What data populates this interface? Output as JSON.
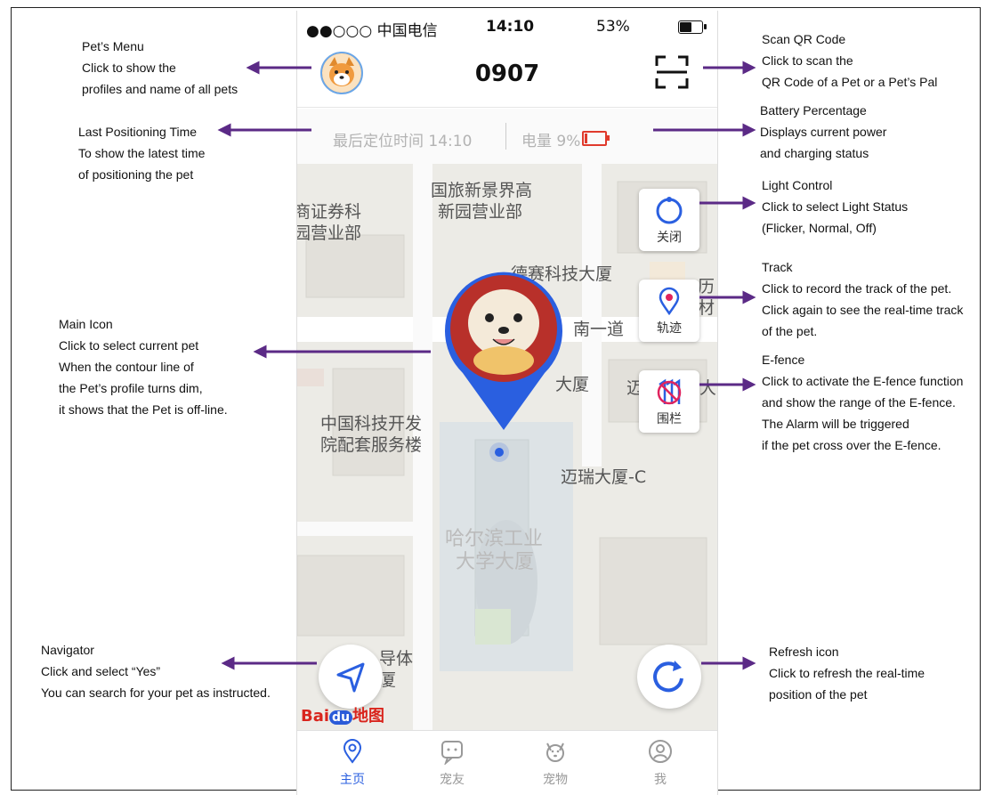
{
  "status_bar": {
    "carrier": "●●○○○ 中国电信",
    "time": "14:10",
    "right": "53%"
  },
  "header": {
    "title": "0907"
  },
  "info_bar": {
    "last_position": "最后定位时间 14:10",
    "battery": "电量 9%"
  },
  "map": {
    "pois": [
      "国旅新景界高",
      "新园营业部",
      "商证券科",
      "园营业部",
      "德赛科技大厦",
      "南一道",
      "大厦",
      "迈",
      "大",
      "中国科技开发",
      "院配套服务楼",
      "迈瑞大厦-C",
      "哈尔滨工业",
      "大学大厦",
      "导体",
      "厦",
      "历",
      "材"
    ],
    "watermark": {
      "bai": "Bai",
      "du": "du",
      "map": "地图"
    }
  },
  "controls": {
    "light_label": "关闭",
    "track_label": "轨迹",
    "fence_label": "围栏"
  },
  "tabs": [
    {
      "label": "主页",
      "icon": "location-pin-icon",
      "active": true
    },
    {
      "label": "宠友",
      "icon": "chat-bubble-icon",
      "active": false
    },
    {
      "label": "宠物",
      "icon": "dog-face-icon",
      "active": false
    },
    {
      "label": "我",
      "icon": "person-icon",
      "active": false
    }
  ],
  "annotations": {
    "pets_menu": [
      "Pet’s Menu",
      "Click to show the",
      "profiles and name of all pets"
    ],
    "last_time": [
      "Last Positioning Time",
      "To show the latest time",
      "of positioning the pet"
    ],
    "main_icon": [
      "Main Icon",
      "Click to select current pet",
      "When the contour line of",
      "the Pet’s profile turns dim,",
      "it shows that the Pet is off-line."
    ],
    "navigator": [
      "Navigator",
      "Click and select “Yes”",
      "You can search for your pet as instructed."
    ],
    "scan": [
      "Scan QR Code",
      "Click to scan the",
      "QR Code of a Pet or a Pet’s Pal"
    ],
    "battery": [
      "Battery Percentage",
      "Displays current power",
      "and charging status"
    ],
    "light": [
      "Light Control",
      "Click to select Light Status",
      "(Flicker, Normal, Off)"
    ],
    "track": [
      "Track",
      "Click to record the track of the pet.",
      "Click again to see the real-time track",
      "of the pet."
    ],
    "efence": [
      "E-fence",
      "Click to activate the E-fence function",
      "and show the range of the E-fence.",
      "The Alarm will be triggered",
      "if the pet cross over the E-fence."
    ],
    "refresh": [
      "Refresh icon",
      "Click to refresh the real-time",
      "position of the pet"
    ]
  },
  "colors": {
    "accent": "#2a5fe0",
    "arrow": "#5b2a86",
    "warning": "#e03a2c"
  }
}
